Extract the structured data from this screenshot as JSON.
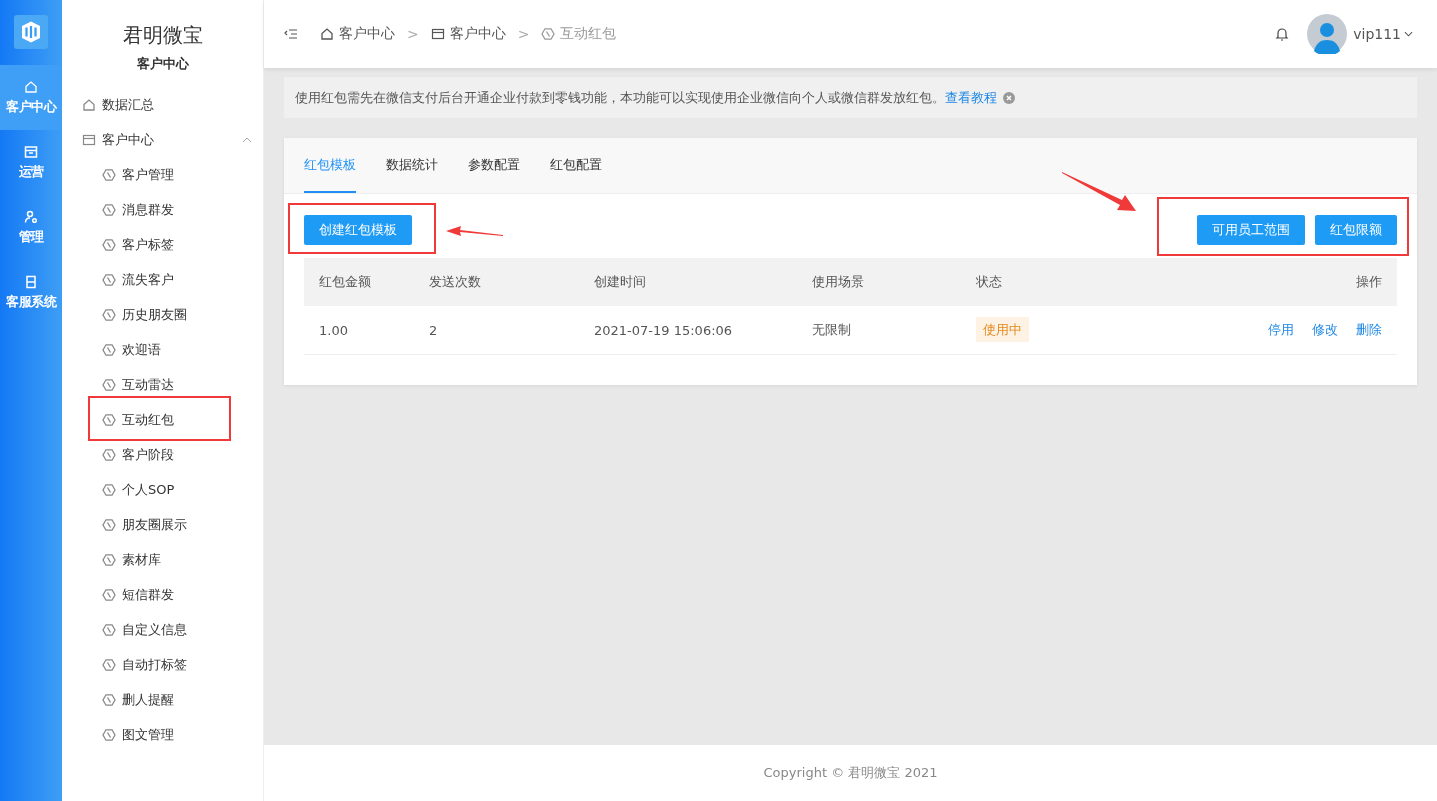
{
  "rail": {
    "items": [
      {
        "label": "客户中心",
        "kind": "home",
        "selected": true
      },
      {
        "label": "运营",
        "kind": "box",
        "selected": false
      },
      {
        "label": "管理",
        "kind": "user",
        "selected": false
      },
      {
        "label": "客服系统",
        "kind": "calendar",
        "selected": false
      }
    ]
  },
  "sidebar": {
    "brand": "君明微宝",
    "section": "客户中心",
    "items": [
      {
        "label": "数据汇总",
        "kind": "home"
      },
      {
        "label": "客户中心",
        "kind": "window",
        "expanded": true,
        "children": [
          {
            "label": "客户管理"
          },
          {
            "label": "消息群发"
          },
          {
            "label": "客户标签"
          },
          {
            "label": "流失客户"
          },
          {
            "label": "历史朋友圈"
          },
          {
            "label": "欢迎语"
          },
          {
            "label": "互动雷达"
          },
          {
            "label": "互动红包"
          },
          {
            "label": "客户阶段"
          },
          {
            "label": "个人SOP"
          },
          {
            "label": "朋友圈展示"
          },
          {
            "label": "素材库"
          },
          {
            "label": "短信群发"
          },
          {
            "label": "自定义信息"
          },
          {
            "label": "自动打标签"
          },
          {
            "label": "删人提醒"
          },
          {
            "label": "图文管理"
          }
        ]
      }
    ]
  },
  "breadcrumb": {
    "separator": ">",
    "items": [
      {
        "label": "客户中心",
        "kind": "home"
      },
      {
        "label": "客户中心",
        "kind": "window"
      },
      {
        "label": "互动红包",
        "kind": "hex"
      }
    ]
  },
  "user": {
    "name": "vip111"
  },
  "notice": {
    "text": "使用红包需先在微信支付后台开通企业付款到零钱功能，本功能可以实现使用企业微信向个人或微信群发放红包。",
    "link": "查看教程"
  },
  "tabs": [
    {
      "label": "红包模板",
      "selected": true
    },
    {
      "label": "数据统计",
      "selected": false
    },
    {
      "label": "参数配置",
      "selected": false
    },
    {
      "label": "红包配置",
      "selected": false
    }
  ],
  "buttons": {
    "left": [
      "创建红包模板"
    ],
    "right": [
      "可用员工范围",
      "红包限额"
    ]
  },
  "table": {
    "columns": [
      "红包金额",
      "发送次数",
      "创建时间",
      "使用场景",
      "状态",
      "操作"
    ],
    "rows": [
      {
        "cells": [
          "1.00",
          "2",
          "2021-07-19 15:06:06",
          "无限制"
        ],
        "status": "使用中",
        "actions": [
          "停用",
          "修改",
          "删除"
        ]
      }
    ]
  },
  "footer": {
    "text": "Copyright © 君明微宝 2021"
  }
}
